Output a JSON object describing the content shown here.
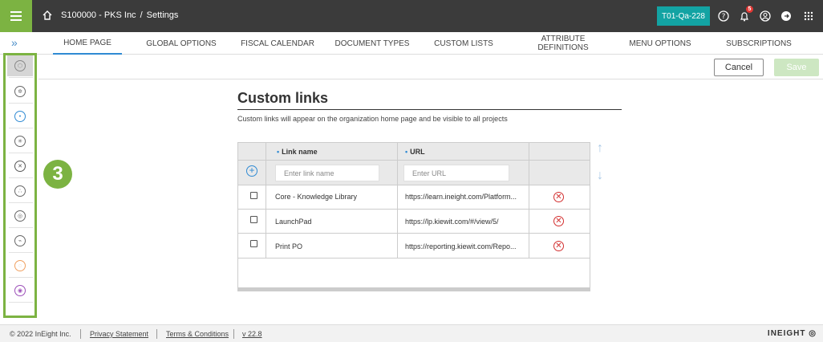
{
  "header": {
    "breadcrumb": "S100000 - PKS Inc",
    "breadcrumb_sep": "/",
    "page": "Settings",
    "environment": "T01-Qa-228",
    "notification_count": "5"
  },
  "nav": {
    "tabs": [
      {
        "label": "HOME PAGE",
        "active": true
      },
      {
        "label": "GLOBAL OPTIONS"
      },
      {
        "label": "FISCAL CALENDAR"
      },
      {
        "label": "DOCUMENT TYPES"
      },
      {
        "label": "CUSTOM LISTS"
      },
      {
        "label": "ATTRIBUTE",
        "label2": "DEFINITIONS"
      },
      {
        "label": "MENU OPTIONS"
      },
      {
        "label": "SUBSCRIPTIONS"
      }
    ]
  },
  "actions": {
    "cancel": "Cancel",
    "save": "Save"
  },
  "step_badge": "3",
  "content": {
    "title": "Custom links",
    "description": "Custom links will appear on the organization home page and be visible to all projects"
  },
  "grid": {
    "columns": [
      "Link name",
      "URL"
    ],
    "required_marker": "•",
    "new_row": {
      "name_placeholder": "Enter link name",
      "url_placeholder": "Enter URL"
    },
    "rows": [
      {
        "name": "Core - Knowledge Library",
        "url": "https://learn.ineight.com/Platform..."
      },
      {
        "name": "LaunchPad",
        "url": "https://lp.kiewit.com/#/view/5/"
      },
      {
        "name": "Print PO",
        "url": "https://reporting.kiewit.com/Repo..."
      }
    ]
  },
  "footer": {
    "copyright": "© 2022 InEight Inc.",
    "privacy": "Privacy Statement",
    "terms": "Terms & Conditions",
    "version": "v 22.8",
    "brand": "INEIGHT"
  },
  "colors": {
    "accent_green": "#7cb342",
    "topbar": "#3b3b3b",
    "env_teal": "#13a3a3",
    "link_blue": "#2f8ad3",
    "delete_red": "#d32f2f"
  }
}
